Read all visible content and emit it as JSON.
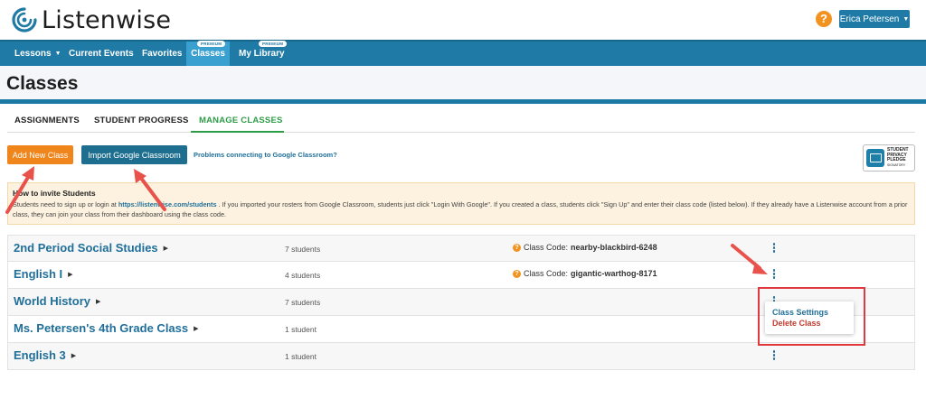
{
  "header": {
    "logo_text": "Listenwise",
    "help_icon": "question-circle-icon",
    "user_name": "Erica Petersen",
    "colors": {
      "brand": "#1f7aa6",
      "accent": "#f0851c",
      "active_tab": "#2d9d47"
    }
  },
  "nav": {
    "items": [
      {
        "label": "Lessons"
      },
      {
        "label": "Current Events"
      },
      {
        "label": "Favorites"
      },
      {
        "label": "Classes",
        "badge": "PREMIUM"
      },
      {
        "label": "My Library",
        "badge": "PREMIUM"
      }
    ]
  },
  "page": {
    "title": "Classes"
  },
  "tabs": [
    {
      "label": "ASSIGNMENTS"
    },
    {
      "label": "STUDENT PROGRESS"
    },
    {
      "label": "MANAGE CLASSES"
    }
  ],
  "actions": {
    "add_class": "Add New Class",
    "import_google": "Import Google Classroom",
    "problems_link": "Problems connecting to Google Classroom?"
  },
  "pledge": {
    "line1": "STUDENT",
    "line2": "PRIVACY",
    "line3": "PLEDGE",
    "line4": "SIGNATORY"
  },
  "banner": {
    "title": "How to invite Students",
    "text_before": "Students need to sign up or login at ",
    "url": "https://listenwise.com/students",
    "text_after": " . If you imported your rosters from Google Classroom, students just click \"Login With Google\". If you created a class, students click \"Sign Up\" and enter their class code (listed below). If they already have a Listenwise account from a prior class, they can join your class from their dashboard using the class code."
  },
  "classes": [
    {
      "name": "2nd Period Social Studies",
      "count": "7 students",
      "code_label": "Class Code:",
      "code": "nearby-blackbird-6248"
    },
    {
      "name": "English I",
      "count": "4 students",
      "code_label": "Class Code:",
      "code": "gigantic-warthog-8171"
    },
    {
      "name": "World History",
      "count": "7 students"
    },
    {
      "name": "Ms. Petersen's 4th Grade Class",
      "count": "1 student"
    },
    {
      "name": "English 3",
      "count": "1 student"
    }
  ],
  "row_menu": {
    "settings": "Class Settings",
    "delete": "Delete Class"
  }
}
